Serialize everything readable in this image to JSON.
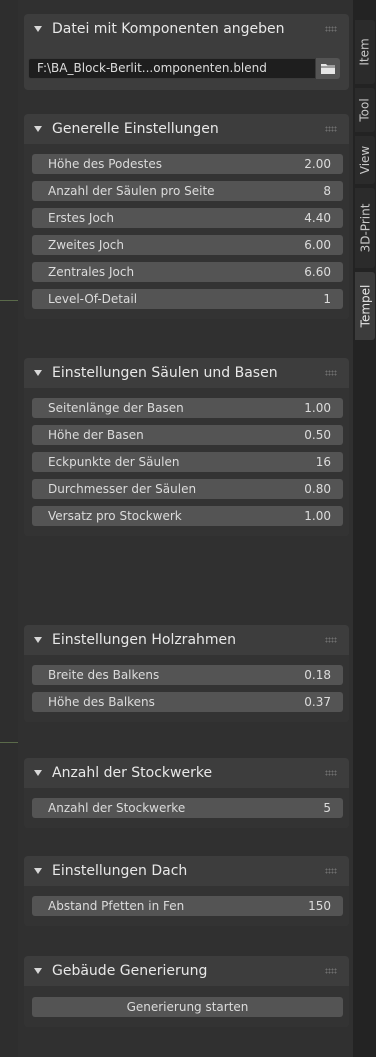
{
  "tabs": [
    {
      "label": "Item",
      "active": false
    },
    {
      "label": "Tool",
      "active": false
    },
    {
      "label": "View",
      "active": false
    },
    {
      "label": "3D-Print",
      "active": false
    },
    {
      "label": "Tempel",
      "active": true
    }
  ],
  "file_section": {
    "title": "Datei mit Komponenten angeben",
    "path_value": "F:\\BA_Block-Berlit...omponenten.blend",
    "browse_icon": "folder-icon"
  },
  "general": {
    "title": "Generelle Einstellungen",
    "props": [
      {
        "label": "Höhe des Podestes",
        "value": "2.00"
      },
      {
        "label": "Anzahl der Säulen pro Seite",
        "value": "8"
      },
      {
        "label": "Erstes Joch",
        "value": "4.40"
      },
      {
        "label": "Zweites Joch",
        "value": "6.00"
      },
      {
        "label": "Zentrales Joch",
        "value": "6.60"
      },
      {
        "label": "Level-Of-Detail",
        "value": "1"
      }
    ]
  },
  "columns": {
    "title": "Einstellungen Säulen und Basen",
    "props": [
      {
        "label": "Seitenlänge der Basen",
        "value": "1.00"
      },
      {
        "label": "Höhe der Basen",
        "value": "0.50"
      },
      {
        "label": "Eckpunkte der Säulen",
        "value": "16"
      },
      {
        "label": "Durchmesser der Säulen",
        "value": "0.80"
      },
      {
        "label": "Versatz pro Stockwerk",
        "value": "1.00"
      }
    ]
  },
  "wood": {
    "title": "Einstellungen Holzrahmen",
    "props": [
      {
        "label": "Breite des Balkens",
        "value": "0.18"
      },
      {
        "label": "Höhe des Balkens",
        "value": "0.37"
      }
    ]
  },
  "floors": {
    "title": "Anzahl der Stockwerke",
    "props": [
      {
        "label": "Anzahl der Stockwerke",
        "value": "5"
      }
    ]
  },
  "roof": {
    "title": "Einstellungen Dach",
    "props": [
      {
        "label": "Abstand Pfetten in Fen",
        "value": "150"
      }
    ]
  },
  "generate": {
    "title": "Gebäude Generierung",
    "button_label": "Generierung starten"
  },
  "colors": {
    "panel_bg": "#3d3d3d",
    "field_bg": "#545454",
    "tab_active": "#3c3c3c"
  }
}
